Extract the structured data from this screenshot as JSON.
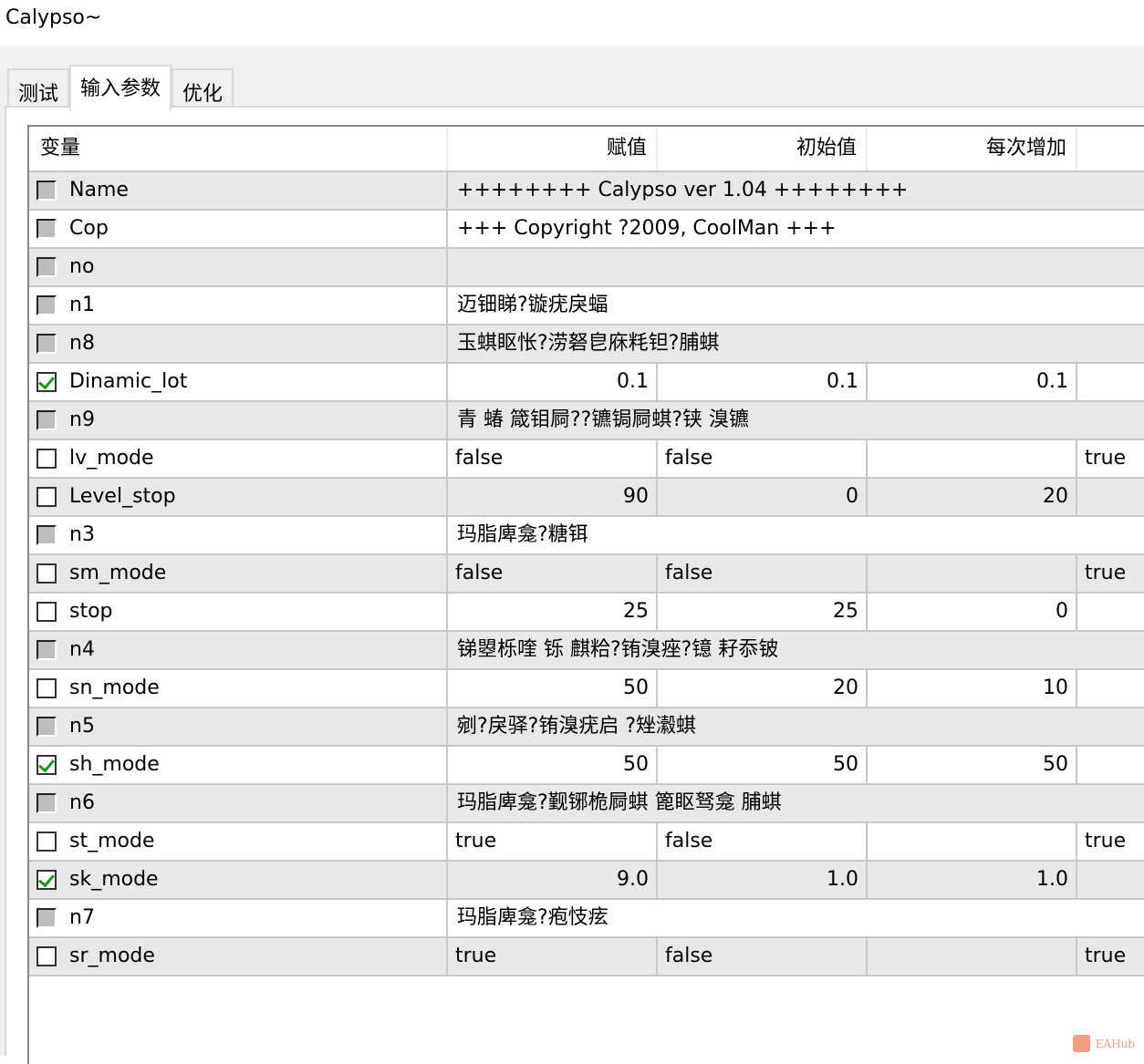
{
  "window": {
    "title": "Calypso~"
  },
  "tabs": [
    {
      "label": "测试"
    },
    {
      "label": "输入参数",
      "active": true
    },
    {
      "label": "优化"
    }
  ],
  "columns": {
    "variable": "变量",
    "value": "赋值",
    "start": "初始值",
    "step": "每次增加"
  },
  "rows": [
    {
      "name": "Name",
      "check": "disabled",
      "text": "++++++++ Calypso ver 1.04 ++++++++"
    },
    {
      "name": "Cop",
      "check": "disabled",
      "text": "+++ Copyright ?2009, CoolMan +++"
    },
    {
      "name": "no",
      "check": "disabled",
      "text": ""
    },
    {
      "name": "n1",
      "check": "disabled",
      "text": "迈钿睇?镟疣戾蝠"
    },
    {
      "name": "n8",
      "check": "disabled",
      "text": "玉蜞眍怅?涝砮皀庥粍钽?脯蜞"
    },
    {
      "name": "Dinamic_lot",
      "check": "on",
      "type": "num",
      "value": "0.1",
      "start": "0.1",
      "step": "0.1",
      "stop": ""
    },
    {
      "name": "n9",
      "check": "disabled",
      "text": "青    蝽     箴钼屙??镳锔屙蜞?铗 溴镳"
    },
    {
      "name": "lv_mode",
      "check": "off",
      "type": "bool",
      "value": "false",
      "start": "false",
      "step": "",
      "stop": "true"
    },
    {
      "name": "Level_stop",
      "check": "off",
      "type": "num",
      "value": "90",
      "start": "0",
      "step": "20",
      "stop": ""
    },
    {
      "name": "n3",
      "check": "disabled",
      "text": "玛脂庳龛?糖铒"
    },
    {
      "name": "sm_mode",
      "check": "off",
      "type": "bool",
      "value": "false",
      "start": "false",
      "step": "",
      "stop": "true"
    },
    {
      "name": "stop",
      "check": "off",
      "type": "num",
      "value": "25",
      "start": "25",
      "step": "0",
      "stop": ""
    },
    {
      "name": "n4",
      "check": "disabled",
      "text": "锑曌栎喹    铄 麒粭?铕溴痤?镱 耔忝铍"
    },
    {
      "name": "sn_mode",
      "check": "off",
      "type": "num",
      "value": "50",
      "start": "20",
      "step": "10",
      "stop": ""
    },
    {
      "name": "n5",
      "check": "disabled",
      "text": "剜?戾驿?铕溴疣启 ?矬瀫蜞"
    },
    {
      "name": "sh_mode",
      "check": "on",
      "type": "num",
      "value": "50",
      "start": "50",
      "step": "50",
      "stop": ""
    },
    {
      "name": "n6",
      "check": "disabled",
      "text": "玛脂庳龛?觐铘桅屙蜞 篦眍驽龛     脯蜞"
    },
    {
      "name": "st_mode",
      "check": "off",
      "type": "bool",
      "value": "true",
      "start": "false",
      "step": "",
      "stop": "true"
    },
    {
      "name": "sk_mode",
      "check": "on",
      "type": "num",
      "value": "9.0",
      "start": "1.0",
      "step": "1.0",
      "stop": ""
    },
    {
      "name": "n7",
      "check": "disabled",
      "text": "玛脂庳龛?疱忮痃"
    },
    {
      "name": "sr_mode",
      "check": "off",
      "type": "bool",
      "value": "true",
      "start": "false",
      "step": "",
      "stop": "true"
    }
  ],
  "watermark": "EAHub"
}
